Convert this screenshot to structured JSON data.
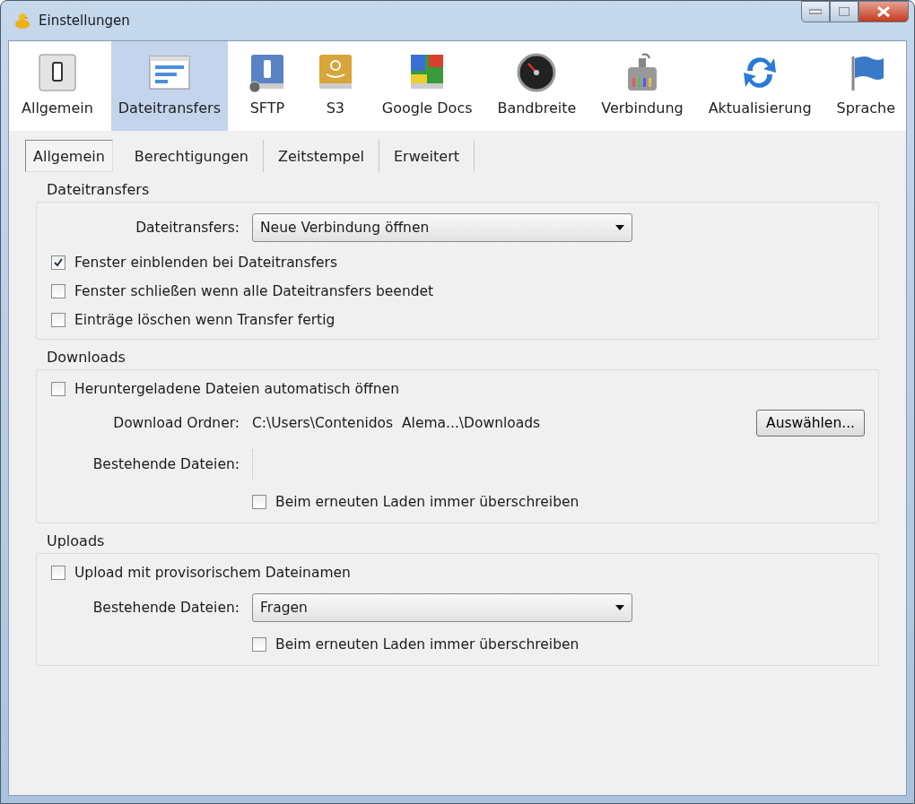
{
  "window": {
    "title": "Einstellungen"
  },
  "toolbar": [
    {
      "label": "Allgemein",
      "selected": false
    },
    {
      "label": "Dateitransfers",
      "selected": true
    },
    {
      "label": "SFTP",
      "selected": false
    },
    {
      "label": "S3",
      "selected": false
    },
    {
      "label": "Google Docs",
      "selected": false
    },
    {
      "label": "Bandbreite",
      "selected": false
    },
    {
      "label": "Verbindung",
      "selected": false
    },
    {
      "label": "Aktualisierung",
      "selected": false
    },
    {
      "label": "Sprache",
      "selected": false
    }
  ],
  "tabs": [
    {
      "label": "Allgemein",
      "selected": true
    },
    {
      "label": "Berechtigungen",
      "selected": false
    },
    {
      "label": "Zeitstempel",
      "selected": false
    },
    {
      "label": "Erweitert",
      "selected": false
    }
  ],
  "sections": [
    {
      "title": "Dateitransfers",
      "rows": [
        {
          "kind": "select",
          "label": "Dateitransfers:",
          "value": "Neue Verbindung öffnen"
        },
        {
          "kind": "checkbox",
          "label": "Fenster einblenden bei Dateitransfers",
          "checked": true
        },
        {
          "kind": "checkbox",
          "label": "Fenster schließen wenn alle Dateitransfers beendet",
          "checked": false
        },
        {
          "kind": "checkbox",
          "label": "Einträge löschen wenn Transfer fertig",
          "checked": false
        }
      ]
    },
    {
      "title": "Downloads",
      "rows": [
        {
          "kind": "checkbox",
          "label": "Heruntergeladene Dateien automatisch öffnen",
          "checked": false
        },
        {
          "kind": "path",
          "label": "Download Ordner:",
          "value": "C:\\Users\\Contenidos  Alema...\\Downloads",
          "button": "Auswählen..."
        },
        {
          "kind": "blank",
          "label": "Bestehende Dateien:"
        },
        {
          "kind": "subcheckbox",
          "label": "Beim erneuten Laden immer überschreiben",
          "checked": false
        }
      ]
    },
    {
      "title": "Uploads",
      "rows": [
        {
          "kind": "checkbox",
          "label": "Upload mit provisorischem Dateinamen",
          "checked": false
        },
        {
          "kind": "select",
          "label": "Bestehende Dateien:",
          "value": "Fragen"
        },
        {
          "kind": "subcheckbox",
          "label": "Beim erneuten Laden immer überschreiben",
          "checked": false
        }
      ]
    }
  ]
}
